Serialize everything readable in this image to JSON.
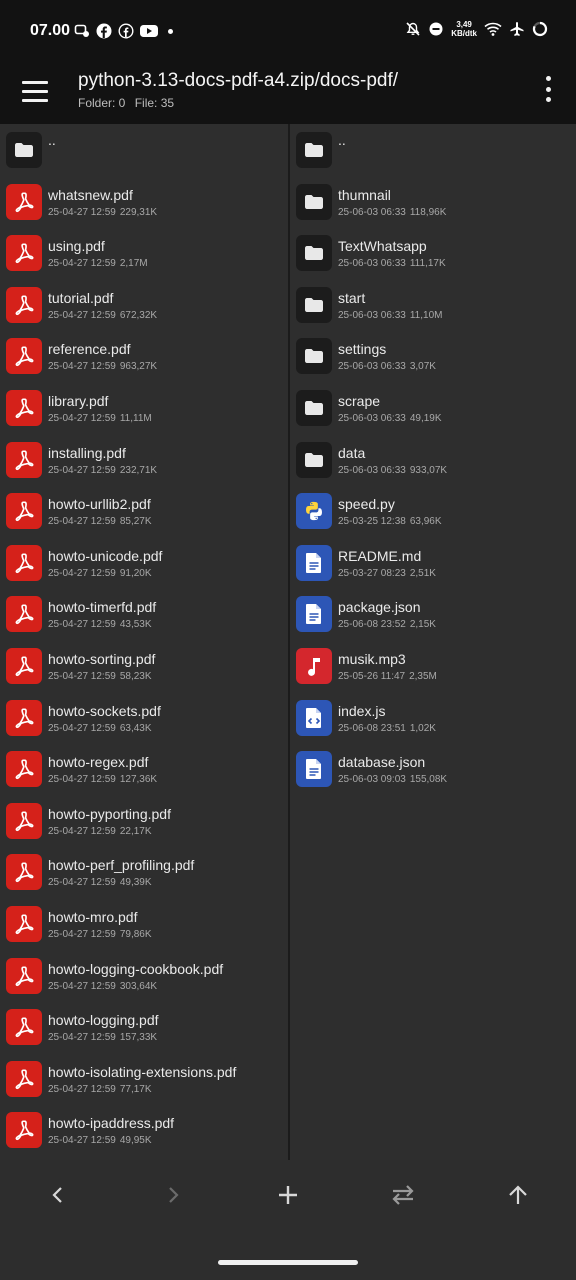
{
  "status_bar": {
    "time": "07.00",
    "net_speed_value": "3,49",
    "net_speed_unit": "KB/dtk"
  },
  "header": {
    "title": "python-3.13-docs-pdf-a4.zip/docs-pdf/",
    "folder_count": "Folder: 0",
    "file_count": "File: 35"
  },
  "left_pane": {
    "parent": "..",
    "files": [
      {
        "name": "whatsnew.pdf",
        "date": "25-04-27 12:59",
        "size": "229,31K"
      },
      {
        "name": "using.pdf",
        "date": "25-04-27 12:59",
        "size": "2,17M"
      },
      {
        "name": "tutorial.pdf",
        "date": "25-04-27 12:59",
        "size": "672,32K"
      },
      {
        "name": "reference.pdf",
        "date": "25-04-27 12:59",
        "size": "963,27K"
      },
      {
        "name": "library.pdf",
        "date": "25-04-27 12:59",
        "size": "11,11M"
      },
      {
        "name": "installing.pdf",
        "date": "25-04-27 12:59",
        "size": "232,71K"
      },
      {
        "name": "howto-urllib2.pdf",
        "date": "25-04-27 12:59",
        "size": "85,27K"
      },
      {
        "name": "howto-unicode.pdf",
        "date": "25-04-27 12:59",
        "size": "91,20K"
      },
      {
        "name": "howto-timerfd.pdf",
        "date": "25-04-27 12:59",
        "size": "43,53K"
      },
      {
        "name": "howto-sorting.pdf",
        "date": "25-04-27 12:59",
        "size": "58,23K"
      },
      {
        "name": "howto-sockets.pdf",
        "date": "25-04-27 12:59",
        "size": "63,43K"
      },
      {
        "name": "howto-regex.pdf",
        "date": "25-04-27 12:59",
        "size": "127,36K"
      },
      {
        "name": "howto-pyporting.pdf",
        "date": "25-04-27 12:59",
        "size": "22,17K"
      },
      {
        "name": "howto-perf_profiling.pdf",
        "date": "25-04-27 12:59",
        "size": "49,39K"
      },
      {
        "name": "howto-mro.pdf",
        "date": "25-04-27 12:59",
        "size": "79,86K"
      },
      {
        "name": "howto-logging-cookbook.pdf",
        "date": "25-04-27 12:59",
        "size": "303,64K"
      },
      {
        "name": "howto-logging.pdf",
        "date": "25-04-27 12:59",
        "size": "157,33K"
      },
      {
        "name": "howto-isolating-extensions.pdf",
        "date": "25-04-27 12:59",
        "size": "77,17K"
      },
      {
        "name": "howto-ipaddress.pdf",
        "date": "25-04-27 12:59",
        "size": "49,95K"
      }
    ]
  },
  "right_pane": {
    "parent": "..",
    "items": [
      {
        "name": "thumnail",
        "date": "25-06-03 06:33",
        "size": "118,96K",
        "type": "folder"
      },
      {
        "name": "TextWhatsapp",
        "date": "25-06-03 06:33",
        "size": "111,17K",
        "type": "folder"
      },
      {
        "name": "start",
        "date": "25-06-03 06:33",
        "size": "11,10M",
        "type": "folder"
      },
      {
        "name": "settings",
        "date": "25-06-03 06:33",
        "size": "3,07K",
        "type": "folder"
      },
      {
        "name": "scrape",
        "date": "25-06-03 06:33",
        "size": "49,19K",
        "type": "folder"
      },
      {
        "name": "data",
        "date": "25-06-03 06:33",
        "size": "933,07K",
        "type": "folder"
      },
      {
        "name": "speed.py",
        "date": "25-03-25 12:38",
        "size": "63,96K",
        "type": "python"
      },
      {
        "name": "README.md",
        "date": "25-03-27 08:23",
        "size": "2,51K",
        "type": "document"
      },
      {
        "name": "package.json",
        "date": "25-06-08 23:52",
        "size": "2,15K",
        "type": "document"
      },
      {
        "name": "musik.mp3",
        "date": "25-05-26 11:47",
        "size": "2,35M",
        "type": "audio"
      },
      {
        "name": "index.js",
        "date": "25-06-08 23:51",
        "size": "1,02K",
        "type": "code"
      },
      {
        "name": "database.json",
        "date": "25-06-03 09:03",
        "size": "155,08K",
        "type": "document"
      }
    ]
  },
  "bottom_bar": {
    "icons": [
      "back-icon",
      "forward-icon",
      "add-icon",
      "swap-icon",
      "up-icon"
    ]
  },
  "colors": {
    "pdf": "#d5211a",
    "document": "#2d56b6",
    "audio": "#d4272d",
    "folder": "#1c1c1c",
    "background": "#2e2e2e"
  }
}
